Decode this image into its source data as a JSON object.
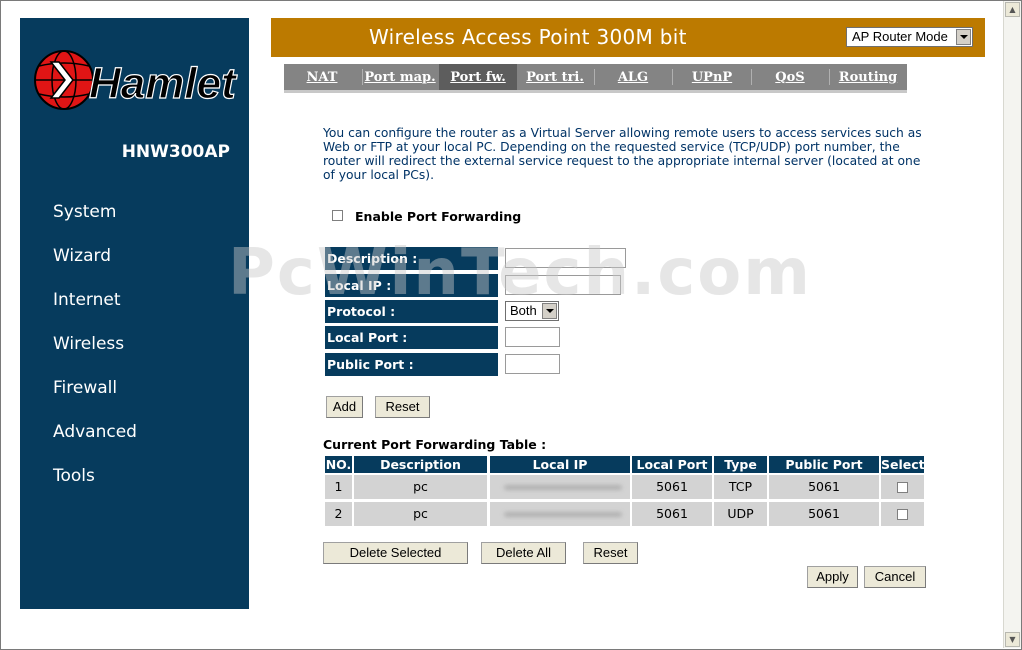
{
  "sidebar": {
    "brand": "Hamlet",
    "model": "HNW300AP",
    "items": [
      {
        "label": "System"
      },
      {
        "label": "Wizard"
      },
      {
        "label": "Internet"
      },
      {
        "label": "Wireless"
      },
      {
        "label": "Firewall"
      },
      {
        "label": "Advanced"
      },
      {
        "label": "Tools"
      }
    ]
  },
  "header": {
    "title": "Wireless Access Point 300M bit",
    "mode_selected": "AP Router Mode",
    "color": "#bc7a00"
  },
  "tabs": [
    {
      "label": "NAT"
    },
    {
      "label": "Port map."
    },
    {
      "label": "Port fw.",
      "active": true
    },
    {
      "label": "Port tri."
    },
    {
      "label": "ALG"
    },
    {
      "label": "UPnP"
    },
    {
      "label": "QoS"
    },
    {
      "label": "Routing"
    }
  ],
  "description": "You can configure the router as a Virtual Server allowing remote users to access services such as Web or FTP at your local PC. Depending on the requested service (TCP/UDP) port number, the router will redirect the external service request to the appropriate internal server (located at one of your local PCs).",
  "enable": {
    "label": "Enable Port Forwarding",
    "checked": false
  },
  "form": {
    "description_label": "Description :",
    "local_ip_label": "Local IP :",
    "protocol_label": "Protocol :",
    "protocol_value": "Both",
    "local_port_label": "Local Port :",
    "public_port_label": "Public Port :",
    "description_value": "",
    "local_ip_value": "",
    "local_port_value": "",
    "public_port_value": ""
  },
  "form_buttons": {
    "add": "Add",
    "reset": "Reset"
  },
  "table": {
    "title": "Current Port Forwarding Table :",
    "columns": [
      "NO.",
      "Description",
      "Local IP",
      "Local Port",
      "Type",
      "Public Port",
      "Select"
    ],
    "rows": [
      {
        "no": "1",
        "description": "pc",
        "local_ip": "",
        "local_port": "5061",
        "type": "TCP",
        "public_port": "5061",
        "selected": false
      },
      {
        "no": "2",
        "description": "pc",
        "local_ip": "",
        "local_port": "5061",
        "type": "UDP",
        "public_port": "5061",
        "selected": false
      }
    ]
  },
  "table_buttons": {
    "delete_selected": "Delete Selected",
    "delete_all": "Delete All",
    "reset": "Reset"
  },
  "page_buttons": {
    "apply": "Apply",
    "cancel": "Cancel"
  },
  "watermark": "PcWinTech.com",
  "colors": {
    "sidebar": "#063b5d",
    "header": "#bc7a00",
    "tabs": "#848484"
  }
}
